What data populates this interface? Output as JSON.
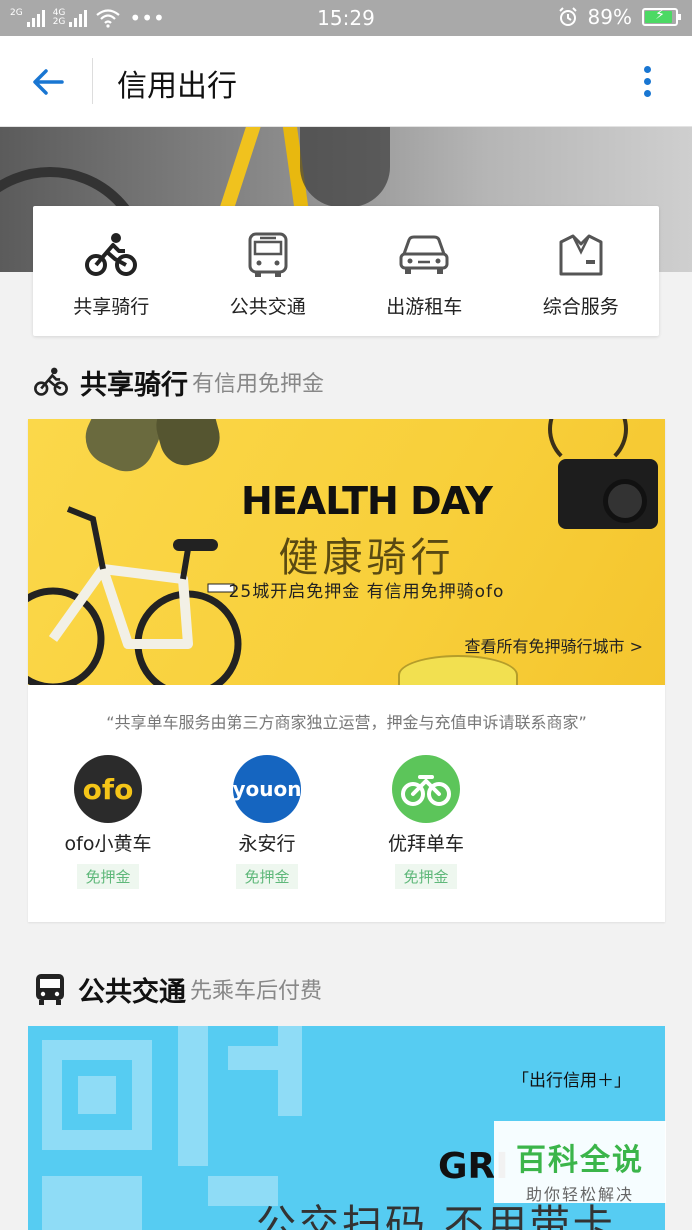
{
  "status_bar": {
    "sim1": "2G",
    "sim2_top": "4G",
    "sim2_bottom": "2G",
    "more": "•••",
    "time": "15:29",
    "battery": "89%",
    "battery_level": 0.89
  },
  "app_bar": {
    "title": "信用出行",
    "accent": "#1976d2"
  },
  "categories": [
    {
      "label": "共享骑行",
      "icon": "bicycle-icon"
    },
    {
      "label": "公共交通",
      "icon": "bus-icon"
    },
    {
      "label": "出游租车",
      "icon": "car-icon"
    },
    {
      "label": "综合服务",
      "icon": "shirt-icon"
    }
  ],
  "bike_section": {
    "title": "共享骑行",
    "subtitle": "有信用免押金",
    "banner": {
      "title": "HEALTH DAY",
      "subtitle": "健康骑行",
      "desc": "25城开启免押金 有信用免押骑ofo",
      "link": "查看所有免押骑行城市 >"
    },
    "notice": "“共享单车服务由第三方商家独立运营，押金与充值申诉请联系商家”",
    "providers": [
      {
        "name": "ofo小黄车",
        "tag": "免押金",
        "logo_text": "ofo",
        "color": "#2b2b2b",
        "logo_color": "#f5c518"
      },
      {
        "name": "永安行",
        "tag": "免押金",
        "logo_text": "youon",
        "color": "#1565c0",
        "logo_color": "#ffffff"
      },
      {
        "name": "优拜单车",
        "tag": "免押金",
        "logo_text": "",
        "color": "#5cc55a",
        "logo_color": "#ffffff"
      }
    ]
  },
  "bus_section": {
    "title": "公共交通",
    "subtitle": "先乘车后付费",
    "banner": {
      "tag": "「出行信用＋」",
      "text": "GRI",
      "big_text": "公交扫码 不用带卡"
    }
  },
  "watermark": {
    "main": "百科全说",
    "sub": "助你轻松解决"
  }
}
